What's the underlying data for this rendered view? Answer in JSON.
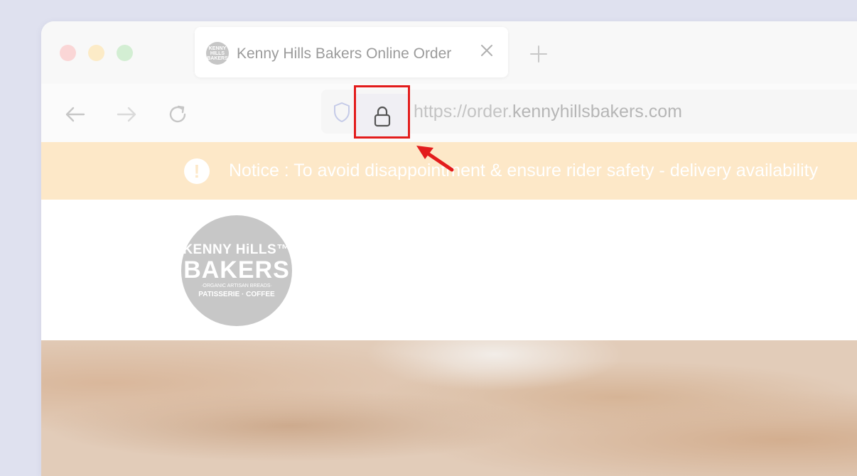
{
  "tab": {
    "title": "Kenny Hills Bakers Online Order",
    "favicon_text": "KENNY HILLS BAKERS"
  },
  "icons": {
    "close_tab": "close-icon",
    "new_tab": "plus-icon",
    "back": "arrow-left-icon",
    "forward": "arrow-right-icon",
    "reload": "reload-icon",
    "tracking_protection": "shield-icon",
    "security": "lock-icon",
    "notice": "exclamation-icon",
    "annotation": "red-arrow"
  },
  "address_bar": {
    "scheme_part": "https://order.",
    "host_part": "kennyhillsbakers.com"
  },
  "notice": {
    "text": "Notice : To avoid disappointment & ensure rider safety - delivery availability"
  },
  "logo": {
    "line1": "KENNY HiLLS™",
    "line2": "BAKERS",
    "line3": "·ORGANIC ARTISAN BREADS·",
    "line4": "PATISSERIE · COFFEE"
  },
  "colors": {
    "page_background": "#dfe1ef",
    "notice_background": "#fde8c8",
    "highlight": "#e31c1c"
  }
}
